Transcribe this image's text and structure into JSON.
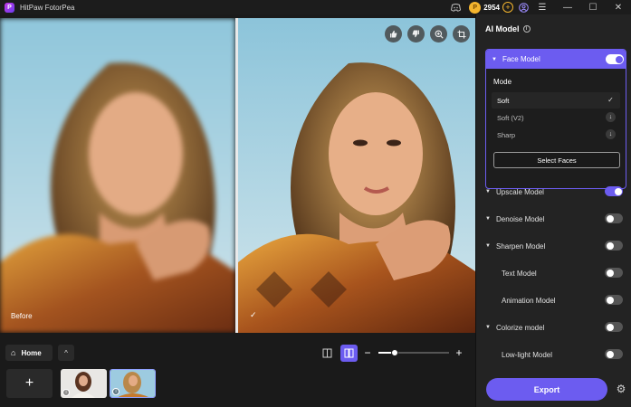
{
  "app": {
    "title": "HitPaw FotorPea",
    "logo_letter": "P"
  },
  "titlebar": {
    "discord_icon": "discord-icon",
    "credits": {
      "value": "2954",
      "coin_symbol": "P",
      "add_symbol": "+"
    },
    "user_icon": "user-icon",
    "menu_icon": "☰",
    "minimize": "—",
    "maximize": "☐",
    "close": "✕"
  },
  "canvas": {
    "before_label": "Before",
    "after_mark": "✓",
    "tools": [
      {
        "name": "thumbs-up-icon",
        "glyph": "👍"
      },
      {
        "name": "thumbs-down-icon",
        "glyph": "👎"
      },
      {
        "name": "zoom-icon",
        "glyph": "⊕"
      },
      {
        "name": "crop-icon",
        "glyph": "⌗"
      }
    ]
  },
  "bottombar": {
    "home_label": "Home",
    "home_glyph": "⌂",
    "collapse_glyph": "^",
    "view_single_glyph": "▯",
    "view_split_glyph": "◫",
    "zoom_minus": "−",
    "zoom_plus": "+",
    "zoom_level": 0.23,
    "add_glyph": "+",
    "thumb_info": "i"
  },
  "panel": {
    "title": "AI Model",
    "info_glyph": "i",
    "face_model": {
      "label": "Face Model",
      "enabled": true,
      "mode_label": "Mode",
      "modes": [
        {
          "label": "Soft",
          "selected": true,
          "right_glyph": "✓"
        },
        {
          "label": "Soft (V2)",
          "selected": false,
          "right_glyph": "↓"
        },
        {
          "label": "Sharp",
          "selected": false,
          "right_glyph": "↓"
        }
      ],
      "select_faces_label": "Select Faces"
    },
    "models": [
      {
        "label": "Upscale Model",
        "has_arrow": true,
        "enabled": true
      },
      {
        "label": "Denoise Model",
        "has_arrow": true,
        "enabled": false
      },
      {
        "label": "Sharpen Model",
        "has_arrow": true,
        "enabled": false
      },
      {
        "label": "Text Model",
        "has_arrow": false,
        "enabled": false
      },
      {
        "label": "Animation Model",
        "has_arrow": false,
        "enabled": false
      },
      {
        "label": "Colorize model",
        "has_arrow": true,
        "enabled": false
      },
      {
        "label": "Low-light Model",
        "has_arrow": false,
        "enabled": false
      }
    ],
    "export_label": "Export",
    "settings_glyph": "⚙"
  },
  "colors": {
    "accent": "#6c5cf0",
    "panel_bg": "#232323",
    "coin": "#f4b52e"
  }
}
